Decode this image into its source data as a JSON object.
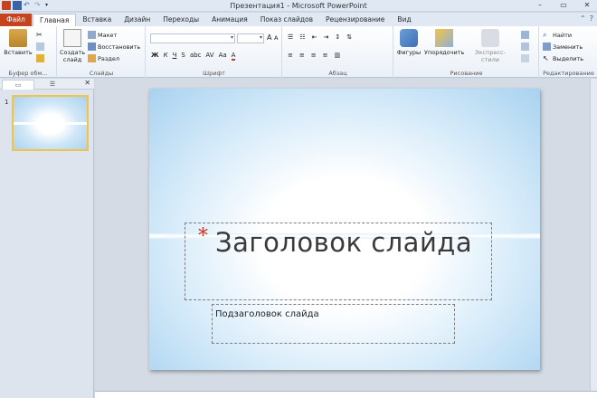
{
  "window": {
    "title": "Презентация1 - Microsoft PowerPoint",
    "minimize": "–",
    "restore": "▭",
    "close": "✕"
  },
  "ribbon_tabs": {
    "file": "Файл",
    "tabs": [
      "Главная",
      "Вставка",
      "Дизайн",
      "Переходы",
      "Анимация",
      "Показ слайдов",
      "Рецензирование",
      "Вид"
    ],
    "active": "Главная"
  },
  "ribbon": {
    "clipboard": {
      "paste": "Вставить",
      "label": "Буфер обм..."
    },
    "slides": {
      "new_slide": "Создать",
      "new_slide2": "слайд",
      "layout": "Макет",
      "reset": "Восстановить",
      "section": "Раздел",
      "label": "Слайды"
    },
    "font": {
      "label": "Шрифт",
      "bold": "Ж",
      "italic": "К",
      "underline": "Ч",
      "strike": "S",
      "shadow": "abc",
      "spacing": "AV",
      "case": "Aa",
      "color": "A",
      "grow": "A",
      "shrink": "A"
    },
    "paragraph": {
      "label": "Абзац"
    },
    "drawing": {
      "shapes": "Фигуры",
      "arrange": "Упорядочить",
      "quick_styles": "Экспресс-стили",
      "label": "Рисование"
    },
    "editing": {
      "find": "Найти",
      "replace": "Заменить",
      "select": "Выделить",
      "label": "Редактирование"
    }
  },
  "pane": {
    "slide_number": "1",
    "close": "✕"
  },
  "slide": {
    "title": "Заголовок слайда",
    "subtitle": "Подзаголовок слайда",
    "star": "*"
  },
  "colors": {
    "file_tab": "#c64320",
    "title_star": "#c0392b",
    "thumb_border": "#f2c445"
  }
}
